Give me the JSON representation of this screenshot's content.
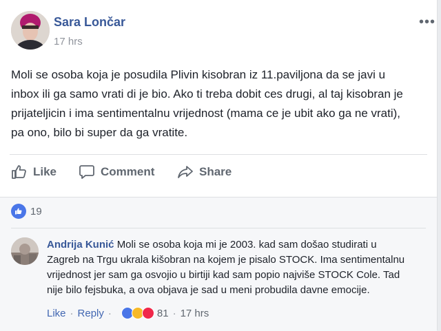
{
  "post": {
    "author": "Sara Lončar",
    "timestamp": "17 hrs",
    "more": "•••",
    "lines": [
      "Moli se osoba koja je posudila Plivin kisobran iz 11.paviljona da se javi u",
      "inbox ili ga samo vrati di je bio. Ako ti treba dobit ces drugi, al taj kisobran je",
      "prijateljicin i ima sentimentalnu vrijednost (mama ce je ubit ako ga ne vrati),",
      "pa ono, bilo bi super da ga vratite."
    ]
  },
  "actions": {
    "like": "Like",
    "comment": "Comment",
    "share": "Share"
  },
  "reactions": {
    "count": "19",
    "icons": [
      "like-icon"
    ]
  },
  "comment": {
    "author": "Andrija Kunić",
    "first_line": "Moli se osoba koja mi je 2003. kad sam došao studirati u",
    "lines": [
      "Zagreb na Trgu ukrala kišobran na kojem je pisalo STOCK. Ima sentimentalnu",
      "vrijednost jer sam ga osvojio u birtiji kad sam popio najviše STOCK Cole. Tad",
      "nije bilo fejsbuka, a ova objava je sad u meni probudila davne emocije."
    ],
    "like": "Like",
    "reply": "Reply",
    "reaction_count": "81",
    "timestamp": "17 hrs",
    "reaction_icons": [
      "like-icon",
      "haha-icon",
      "love-icon"
    ]
  },
  "colors": {
    "link_blue": "#385898",
    "like_blue": "#4a76e8",
    "love_red": "#f0284a",
    "haha_yellow": "#f7b928"
  }
}
